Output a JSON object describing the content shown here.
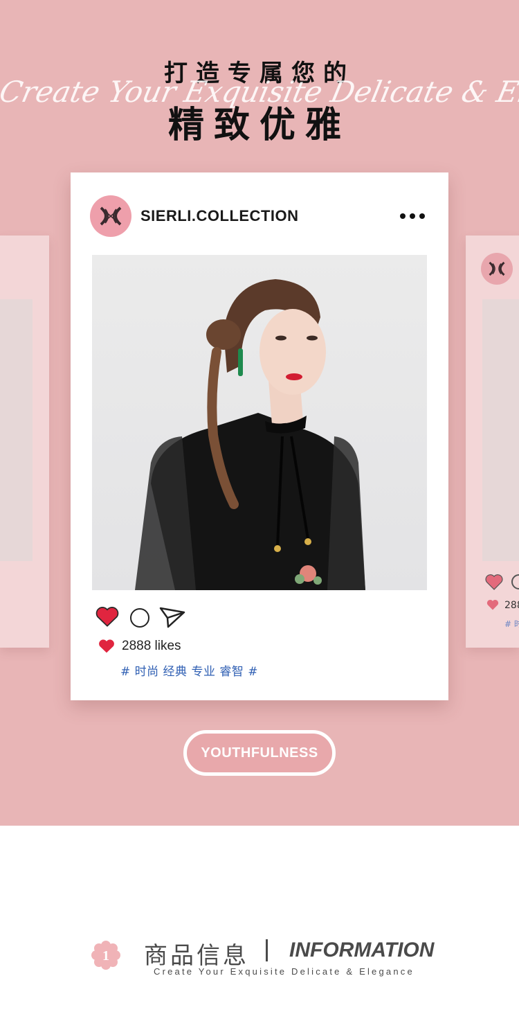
{
  "hero": {
    "title_line1": "打造专属您的",
    "script_line": "Create Your Exquisite Delicate & Elegance",
    "title_line2": "精致优雅"
  },
  "post": {
    "username": "SIERLI.COLLECTION",
    "more_icon": "more-dots-icon",
    "likes": "2888 likes",
    "tags": "# 时尚 经典 专业 睿智 #",
    "photo_description": "model in black embroidered top"
  },
  "ghost_right": {
    "likes": "288",
    "tags": "# 时"
  },
  "button": {
    "label": "YOUTHFULNESS"
  },
  "info": {
    "number": "1",
    "title_cn": "商品信息",
    "title_en": "INFORMATION",
    "subtitle": "Create Your Exquisite Delicate & Elegance"
  },
  "colors": {
    "hero_bg": "#e8b5b6",
    "heart": "#e0253f",
    "tag": "#2f5fb3",
    "accent_pink": "#ee9fab"
  }
}
